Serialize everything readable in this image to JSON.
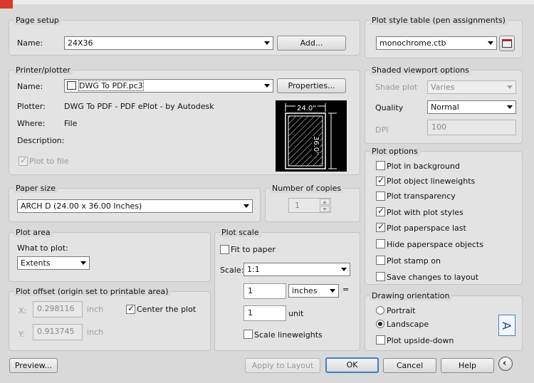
{
  "page_setup": {
    "title": "Page setup",
    "name_label": "Name:",
    "name_value": "24X36",
    "add_button": "Add..."
  },
  "printer": {
    "title": "Printer/plotter",
    "name_label": "Name:",
    "name_value": "DWG To PDF.pc3",
    "properties_button": "Properties...",
    "plotter_label": "Plotter:",
    "plotter_value": "DWG To PDF - PDF ePlot - by Autodesk",
    "where_label": "Where:",
    "where_value": "File",
    "description_label": "Description:",
    "plot_to_file_label": "Plot to file",
    "preview_width": "24.0\"",
    "preview_height": "36.0\""
  },
  "paper_size": {
    "title": "Paper size",
    "value": "ARCH D (24.00 x 36.00 Inches)"
  },
  "copies": {
    "title": "Number of copies",
    "value": "1"
  },
  "plot_area": {
    "title": "Plot area",
    "what_label": "What to plot:",
    "what_value": "Extents"
  },
  "plot_offset": {
    "title": "Plot offset (origin set to printable area)",
    "x_label": "X:",
    "x_value": "0.298116",
    "x_unit": "inch",
    "y_label": "Y:",
    "y_value": "0.913745",
    "y_unit": "inch",
    "center_label": "Center the plot"
  },
  "plot_scale": {
    "title": "Plot scale",
    "fit_label": "Fit to paper",
    "scale_label": "Scale:",
    "scale_value": "1:1",
    "value1": "1",
    "unit1": "inches",
    "equals": "=",
    "value2": "1",
    "unit2": "unit",
    "scale_lw_label": "Scale lineweights"
  },
  "plot_style": {
    "title": "Plot style table (pen assignments)",
    "value": "monochrome.ctb"
  },
  "shaded": {
    "title": "Shaded viewport options",
    "shade_label": "Shade plot",
    "shade_value": "Varies",
    "quality_label": "Quality",
    "quality_value": "Normal",
    "dpi_label": "DPI",
    "dpi_value": "100"
  },
  "plot_options": {
    "title": "Plot options",
    "items": [
      {
        "label": "Plot in background",
        "checked": false
      },
      {
        "label": "Plot object lineweights",
        "checked": true
      },
      {
        "label": "Plot transparency",
        "checked": false
      },
      {
        "label": "Plot with plot styles",
        "checked": true
      },
      {
        "label": "Plot paperspace last",
        "checked": true
      },
      {
        "label": "Hide paperspace objects",
        "checked": false
      },
      {
        "label": "Plot stamp on",
        "checked": false
      },
      {
        "label": "Save changes to layout",
        "checked": false
      }
    ]
  },
  "orientation": {
    "title": "Drawing orientation",
    "portrait_label": "Portrait",
    "landscape_label": "Landscape",
    "upside_label": "Plot upside-down",
    "selected": "Landscape",
    "icon_letter": "A"
  },
  "footer": {
    "preview": "Preview...",
    "apply": "Apply to Layout",
    "ok": "OK",
    "cancel": "Cancel",
    "help": "Help"
  }
}
